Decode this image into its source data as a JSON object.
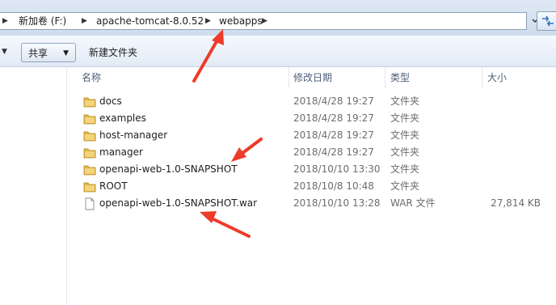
{
  "address": {
    "crumbs": [
      "新加卷 (F:)",
      "apache-tomcat-8.0.52",
      "webapps"
    ]
  },
  "toolbar": {
    "share_label": "共享",
    "new_folder_label": "新建文件夹"
  },
  "columns": {
    "name": "名称",
    "date": "修改日期",
    "type": "类型",
    "size": "大小"
  },
  "files": [
    {
      "name": "docs",
      "date": "2018/4/28 19:27",
      "type": "文件夹",
      "size": "",
      "icon": "folder-icon"
    },
    {
      "name": "examples",
      "date": "2018/4/28 19:27",
      "type": "文件夹",
      "size": "",
      "icon": "folder-icon"
    },
    {
      "name": "host-manager",
      "date": "2018/4/28 19:27",
      "type": "文件夹",
      "size": "",
      "icon": "folder-icon"
    },
    {
      "name": "manager",
      "date": "2018/4/28 19:27",
      "type": "文件夹",
      "size": "",
      "icon": "folder-icon"
    },
    {
      "name": "openapi-web-1.0-SNAPSHOT",
      "date": "2018/10/10 13:30",
      "type": "文件夹",
      "size": "",
      "icon": "folder-icon"
    },
    {
      "name": "ROOT",
      "date": "2018/10/8 10:48",
      "type": "文件夹",
      "size": "",
      "icon": "folder-icon"
    },
    {
      "name": "openapi-web-1.0-SNAPSHOT.war",
      "date": "2018/10/10 13:28",
      "type": "WAR 文件",
      "size": "27,814 KB",
      "icon": "file-icon"
    }
  ],
  "colors": {
    "annotation_arrow": "#ee3b2a",
    "folder": "#e8c35a"
  }
}
